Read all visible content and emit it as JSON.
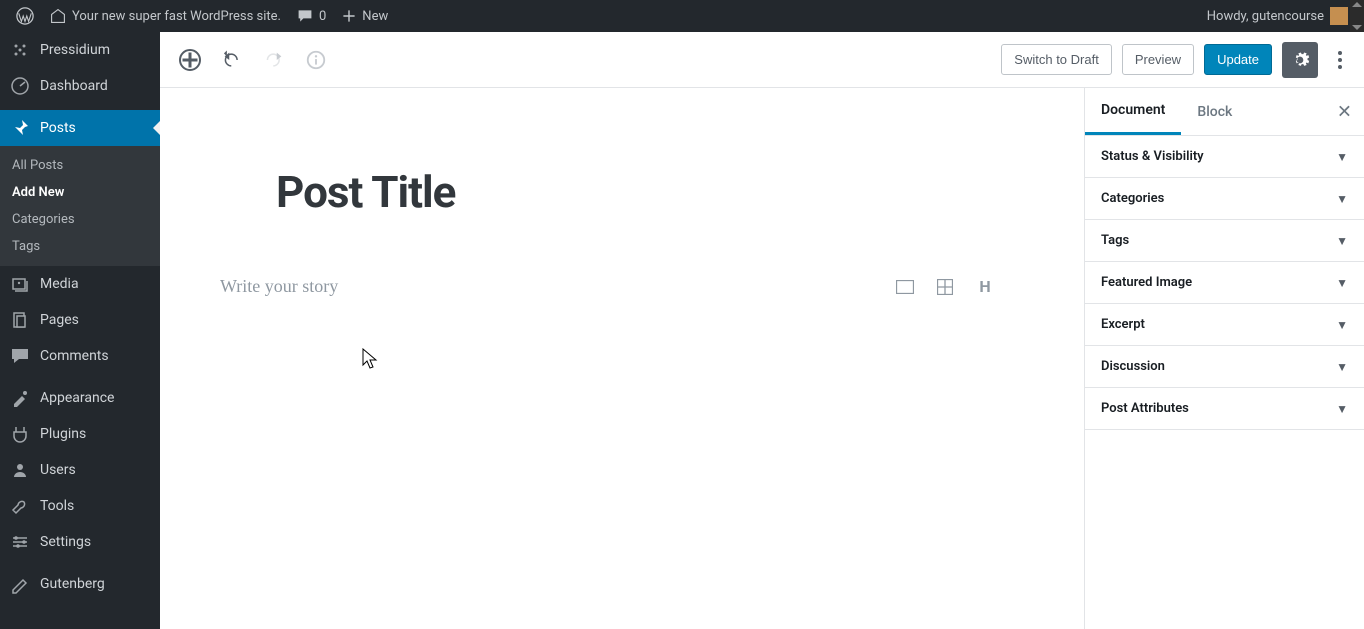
{
  "adminbar": {
    "site_title": "Your new super fast WordPress site.",
    "comments": "0",
    "new": "New",
    "howdy": "Howdy, gutencourse"
  },
  "sidebar": {
    "pressidium": "Pressidium",
    "dashboard": "Dashboard",
    "posts": "Posts",
    "posts_sub": {
      "all": "All Posts",
      "add": "Add New",
      "categories": "Categories",
      "tags": "Tags"
    },
    "media": "Media",
    "pages": "Pages",
    "comments": "Comments",
    "appearance": "Appearance",
    "plugins": "Plugins",
    "users": "Users",
    "tools": "Tools",
    "settings": "Settings",
    "gutenberg": "Gutenberg"
  },
  "topbar": {
    "switch_draft": "Switch to Draft",
    "preview": "Preview",
    "update": "Update"
  },
  "editor": {
    "title": "Post Title",
    "placeholder": "Write your story"
  },
  "rightpanel": {
    "tab_document": "Document",
    "tab_block": "Block",
    "sections": {
      "status": "Status & Visibility",
      "categories": "Categories",
      "tags": "Tags",
      "featured": "Featured Image",
      "excerpt": "Excerpt",
      "discussion": "Discussion",
      "attributes": "Post Attributes"
    }
  }
}
